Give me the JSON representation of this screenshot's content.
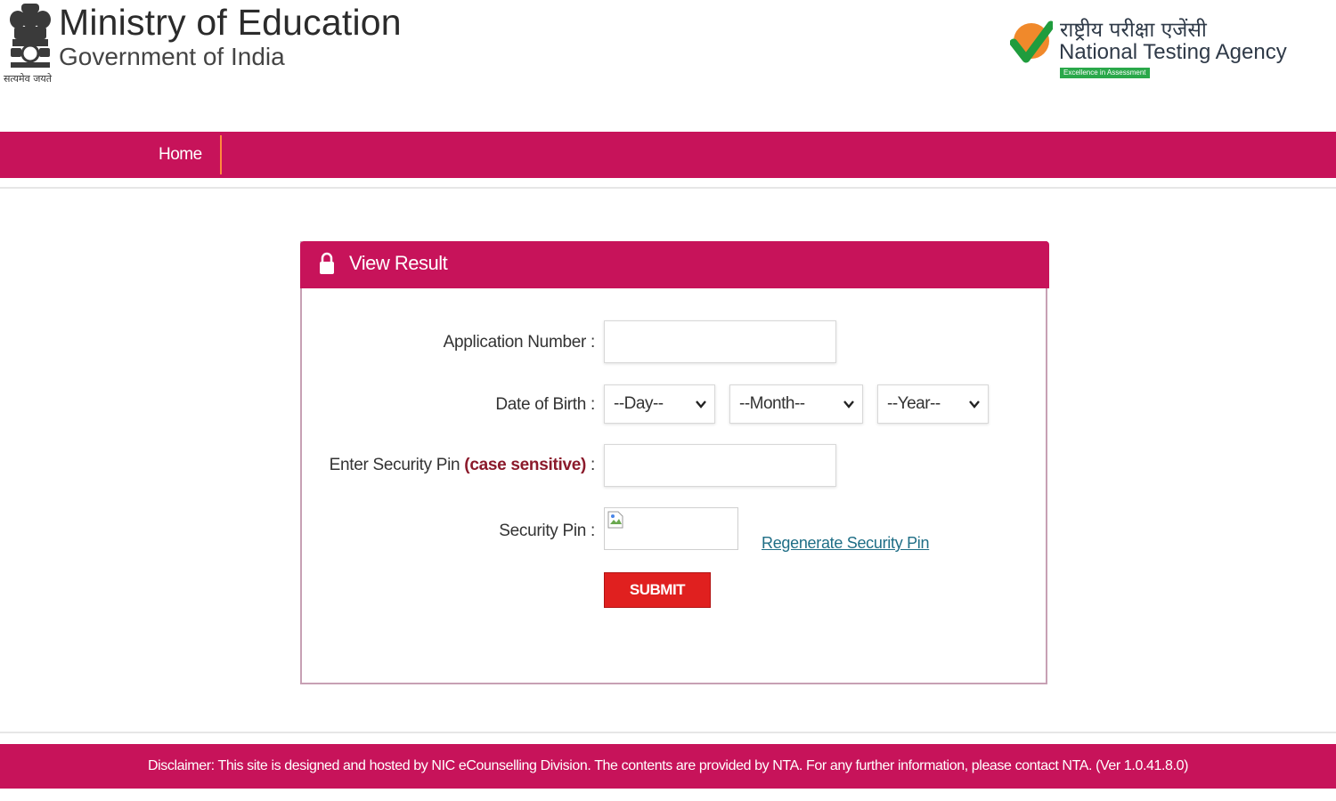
{
  "header": {
    "ministry_title": "Ministry of Education",
    "ministry_subtitle": "Government of India",
    "emblem_motto": "सत्यमेव जयते",
    "agency_hindi": "राष्ट्रीय परीक्षा एजेंसी",
    "agency_name": "National Testing Agency",
    "agency_tagline": "Excellence in Assessment"
  },
  "nav": {
    "home_label": "Home"
  },
  "panel": {
    "title": "View Result",
    "application_number_label": "Application Number :",
    "application_number_value": "",
    "dob_label": "Date of Birth :",
    "day_selected": "--Day--",
    "month_selected": "--Month--",
    "year_selected": "--Year--",
    "security_pin_entry_label_main": "Enter Security Pin",
    "security_pin_entry_label_note": "(case sensitive)",
    "security_pin_entry_label_colon": ":",
    "security_pin_entry_value": "",
    "security_pin_label": "Security Pin :",
    "regenerate_link": "Regenerate Security Pin",
    "submit_label": "SUBMIT"
  },
  "footer": {
    "disclaimer": "Disclaimer: This site is designed and hosted by NIC eCounselling Division. The contents are provided by NTA. For any further information, please contact NTA. (Ver 1.0.41.8.0)"
  },
  "colors": {
    "brand": "#c7135a",
    "submit": "#e0201f",
    "link": "#1f6e86",
    "nav_separator": "#ff8a3d"
  },
  "icons": {
    "emblem": "national-emblem-icon",
    "agency_logo": "nta-checkmark-logo-icon",
    "panel": "lock-icon",
    "select": "chevron-down-icon",
    "captcha": "broken-image-icon"
  }
}
